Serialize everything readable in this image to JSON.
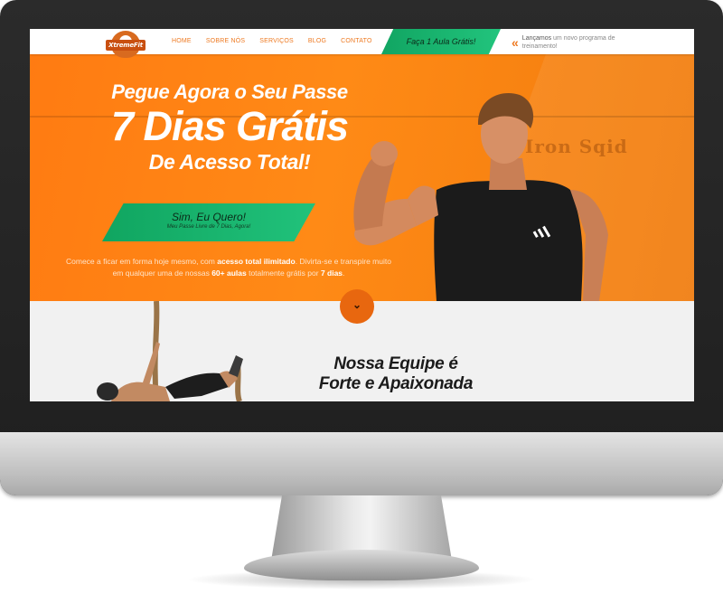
{
  "logo": {
    "text": "XtremeFit"
  },
  "nav": {
    "items": [
      {
        "label": "HOME"
      },
      {
        "label": "SOBRE NÓS"
      },
      {
        "label": "SERVIÇOS"
      },
      {
        "label": "BLOG"
      },
      {
        "label": "CONTATO"
      }
    ]
  },
  "header_cta": {
    "label": "Faça 1 Aula Grátis!"
  },
  "announcement": {
    "icon": "double-chevron-left-icon",
    "text_highlight": "Lançamos",
    "text_rest": " um novo programa de treinamento!"
  },
  "hero": {
    "line1": "Pegue Agora o Seu Passe",
    "line2": "7 Dias Grátis",
    "line3": "De Acesso Total!",
    "cta_label": "Sim, Eu Quero!",
    "cta_sub": "Meu Passe Livre de 7 Dias, Agora!",
    "watermark": "Iron Sqid",
    "desc": {
      "p1": "Comece a ficar em forma hoje mesmo, com ",
      "b1": "acesso total ilimitado",
      "p2": ". Divirta-se e transpire muito em qualquer uma de nossas ",
      "b2": "60+ aulas",
      "p3": " totalmente grátis por ",
      "b3": "7 dias",
      "p4": "."
    }
  },
  "scroll_button": {
    "icon": "chevron-down-icon"
  },
  "section": {
    "title_l1": "Nossa Equipe é",
    "title_l2": "Forte e Apaixonada"
  },
  "colors": {
    "orange": "#ff7b12",
    "green": "#19b56d",
    "nav_text": "#ee7a22",
    "dark": "#1b1b1b"
  }
}
